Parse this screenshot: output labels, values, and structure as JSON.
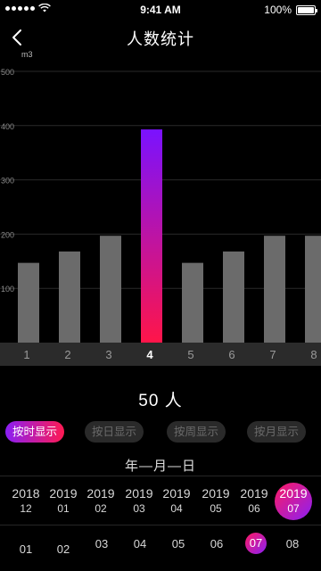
{
  "status": {
    "time": "9:41 AM",
    "battery": "100%"
  },
  "nav": {
    "title": "人数统计",
    "back_icon": "chevron-left-icon"
  },
  "chart_data": {
    "type": "bar",
    "unit_label": "m3",
    "categories": [
      "1",
      "2",
      "3",
      "4",
      "5",
      "6",
      "7",
      "8"
    ],
    "values": [
      147,
      168,
      197,
      393,
      147,
      168,
      197,
      197
    ],
    "yticks": [
      "500",
      "400",
      "300",
      "200",
      "100"
    ],
    "ylim": [
      0,
      500
    ],
    "selected_index": 3,
    "grid": true,
    "colors": {
      "bar": "#6b6b6b",
      "highlight_top": "#7a12ff",
      "highlight_bottom": "#ff1549",
      "axis_bg": "#2b2b2b",
      "selected_label": "#ffffff",
      "label": "#9a9a9a"
    }
  },
  "count": {
    "value": "50",
    "unit": "人"
  },
  "filters": [
    {
      "label": "按时显示",
      "active": true
    },
    {
      "label": "按日显示",
      "active": false
    },
    {
      "label": "按周显示",
      "active": false
    },
    {
      "label": "按月显示",
      "active": false
    }
  ],
  "date_label": "年—月—日",
  "year_months": [
    {
      "year": "2018",
      "month": "12"
    },
    {
      "year": "2019",
      "month": "01"
    },
    {
      "year": "2019",
      "month": "02"
    },
    {
      "year": "2019",
      "month": "03"
    },
    {
      "year": "2019",
      "month": "04"
    },
    {
      "year": "2019",
      "month": "05"
    },
    {
      "year": "2019",
      "month": "06"
    },
    {
      "year": "2019",
      "month": "07",
      "selected": true
    }
  ],
  "days": [
    {
      "label": "01"
    },
    {
      "label": "02"
    },
    {
      "label": "03"
    },
    {
      "label": "04"
    },
    {
      "label": "05"
    },
    {
      "label": "06"
    },
    {
      "label": "07",
      "selected": true
    },
    {
      "label": "08"
    }
  ]
}
